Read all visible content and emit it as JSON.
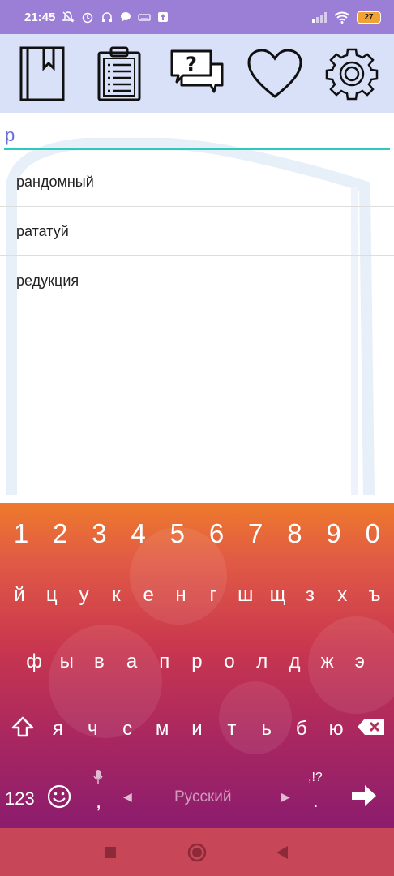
{
  "status_bar": {
    "time": "21:45",
    "battery": "27"
  },
  "toolbar": {
    "items": [
      {
        "name": "dictionary",
        "icon": "book-icon"
      },
      {
        "name": "notes",
        "icon": "clipboard-icon"
      },
      {
        "name": "quiz",
        "icon": "question-chat-icon"
      },
      {
        "name": "favorites",
        "icon": "heart-icon"
      },
      {
        "name": "settings",
        "icon": "gear-icon"
      }
    ],
    "background": "#d9e1f8"
  },
  "search": {
    "value": "р",
    "underline_color": "#2fc8bc"
  },
  "results": [
    {
      "word": "рандомный"
    },
    {
      "word": "рататуй"
    },
    {
      "word": "редукция"
    }
  ],
  "keyboard": {
    "numbers": [
      "1",
      "2",
      "3",
      "4",
      "5",
      "6",
      "7",
      "8",
      "9",
      "0"
    ],
    "row1": [
      "й",
      "ц",
      "у",
      "к",
      "е",
      "н",
      "г",
      "ш",
      "щ",
      "з",
      "х",
      "ъ"
    ],
    "row2": [
      "ф",
      "ы",
      "в",
      "а",
      "п",
      "р",
      "о",
      "л",
      "д",
      "ж",
      "э"
    ],
    "row3": [
      "я",
      "ч",
      "с",
      "м",
      "и",
      "т",
      "ь",
      "б",
      "ю"
    ],
    "mode_key": "123",
    "comma": ",",
    "space_label": "Русский",
    "punct_hint": ",!?",
    "period": "."
  },
  "colors": {
    "status_bar": "#9b7fd6",
    "navbar": "#c74758",
    "search_text": "#6a6fd8"
  }
}
